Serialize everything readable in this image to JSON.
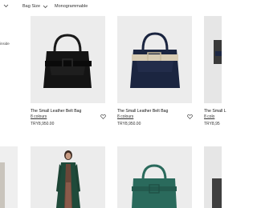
{
  "filters": [
    {
      "label": ""
    },
    {
      "label": "Bag Size"
    },
    {
      "label": "Monogrammable"
    }
  ],
  "side_text": "inside",
  "products": [
    {
      "title": "The Small Leather Belt Bag",
      "colours": "8 colours",
      "price": "TRY8,950.00"
    },
    {
      "title": "The Small Leather Belt Bag",
      "colours": "8 colours",
      "price": "TRY8,950.00"
    },
    {
      "title": "The Small L",
      "colours": "8 colo",
      "price": "TRY8,95"
    }
  ],
  "icons": {
    "chevron": "chevron-down-icon",
    "wishlist": "heart-icon"
  },
  "colors": {
    "card_bg": "#ebebeb",
    "bag_black": "#141414",
    "bag_navy": "#1b2540",
    "coat_green": "#1f4a3a",
    "bag_green": "#2a6a5c"
  }
}
